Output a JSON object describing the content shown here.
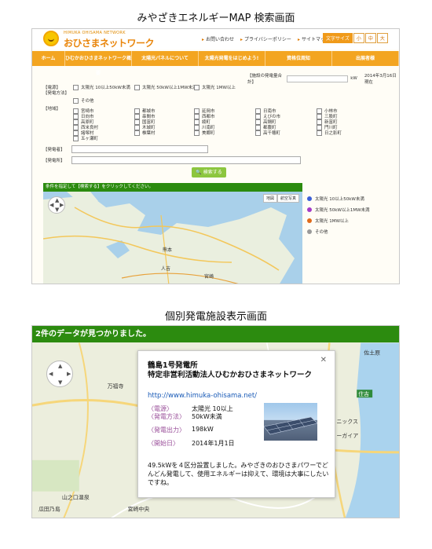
{
  "top_caption": "みやざきエネルギーMAP 検索画面",
  "bottom_caption": "個別発電施設表示画面",
  "top_screen": {
    "logo_sub": "HIMUKA OHISAMA NETWORK",
    "logo_main": "おひさまネットワーク",
    "util_links": [
      "お問い合わせ",
      "プライバシーポリシー",
      "サイトマップ"
    ],
    "font_size_label": "文字サイズ",
    "font_sizes": [
      "小",
      "中",
      "大"
    ],
    "nav": [
      "ホーム",
      "ひむかおひさまネットワーク概要",
      "太陽光パネルについて",
      "太陽光発電をはじめよう!",
      "資格位周知",
      "出展者様"
    ],
    "gen_total_label": "【施設の発電量合計】",
    "gen_total_unit": "kW",
    "gen_total_date": "2014年3月16日現在",
    "power_source_label": "【電源】",
    "method_label": "【発電方法】",
    "power_options": [
      "太陽光 10以上50kW未満",
      "太陽光 50kW以上1MW未満",
      "太陽光 1MW以上",
      "その他"
    ],
    "area_label": "【地域】",
    "areas": [
      "宮崎市",
      "都城市",
      "延岡市",
      "日南市",
      "小林市",
      "日向市",
      "串間市",
      "西都市",
      "えびの市",
      "三股町",
      "高原町",
      "国富町",
      "綾町",
      "高鍋町",
      "新富町",
      "西米良村",
      "木城町",
      "川南町",
      "都農町",
      "門川町",
      "諸塚村",
      "椎葉村",
      "美郷町",
      "高千穂町",
      "日之影町",
      "五ヶ瀬町"
    ],
    "plant_name_label": "【発電者】",
    "plant_location_label": "【発電所】",
    "search_button": "検索する",
    "instruction": "条件を指定して【検索する】をクリックしてください。",
    "map_tabs": [
      "地図",
      "航空写真"
    ],
    "map_labels": [
      "熊本",
      "人吉",
      "宮崎"
    ],
    "legend": [
      {
        "label": "太陽光 10以上50kW未満",
        "color": "#3c5fd8"
      },
      {
        "label": "太陽光 50kW以上1MW未満",
        "color": "#a43bc7"
      },
      {
        "label": "太陽光 1MW以上",
        "color": "#e06a1a"
      },
      {
        "label": "その他",
        "color": "#9a9a9a"
      }
    ]
  },
  "bottom_screen": {
    "result_bar": "2件のデータが見つかりました。",
    "popup": {
      "plant_name": "鶴島1号発電所",
      "owner": "特定非営利活動法人ひむかおひさまネットワーク",
      "url": "http://www.himuka-ohisama.net/",
      "source_label": "〈電源〉",
      "method_label": "〈発電方法〉",
      "source_value": "太陽光 10以上",
      "method_value": "50kW未満",
      "output_label": "〈発電出力〉",
      "output_value": "198kW",
      "start_label": "〈開始日〉",
      "start_value": "2014年1月1日",
      "description": "49.5kWを４区分設置しました。みやざきのおひさまパワーでどんどん発電して、使用エネルギーは抑えて、環境は大事にしたいですね。"
    },
    "map_labels": [
      "万福寺",
      "山之口温泉",
      "瓜田乃島",
      "宮崎中央",
      "住吉",
      "佐土原",
      "ニックス",
      "ーガイア"
    ]
  },
  "colors": {
    "accent_orange": "#f3a521",
    "accent_green": "#2c8b0f",
    "link_blue": "#1a5bb7"
  }
}
